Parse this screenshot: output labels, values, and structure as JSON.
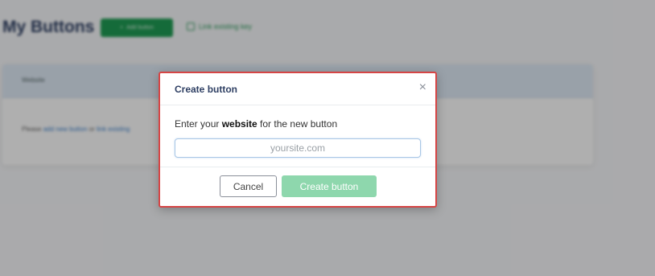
{
  "background": {
    "title": "My Buttons",
    "add_button_label": "Add button",
    "link_existing_label": "Link existing key",
    "card_header": "Website",
    "card_body_prefix": "Please ",
    "card_body_link1": "add new button",
    "card_body_mid": " or ",
    "card_body_link2": "link existing"
  },
  "modal": {
    "title": "Create button",
    "close_symbol": "×",
    "prompt_before": "Enter your ",
    "prompt_bold": "website",
    "prompt_after": " for the new button",
    "input_placeholder": "yoursite.com",
    "input_value": "",
    "cancel_label": "Cancel",
    "create_label": "Create button"
  },
  "colors": {
    "modal_border": "#d64545",
    "primary_green": "#1f9a53",
    "create_disabled": "#8ed7ad",
    "title_navy": "#2e3f63"
  }
}
